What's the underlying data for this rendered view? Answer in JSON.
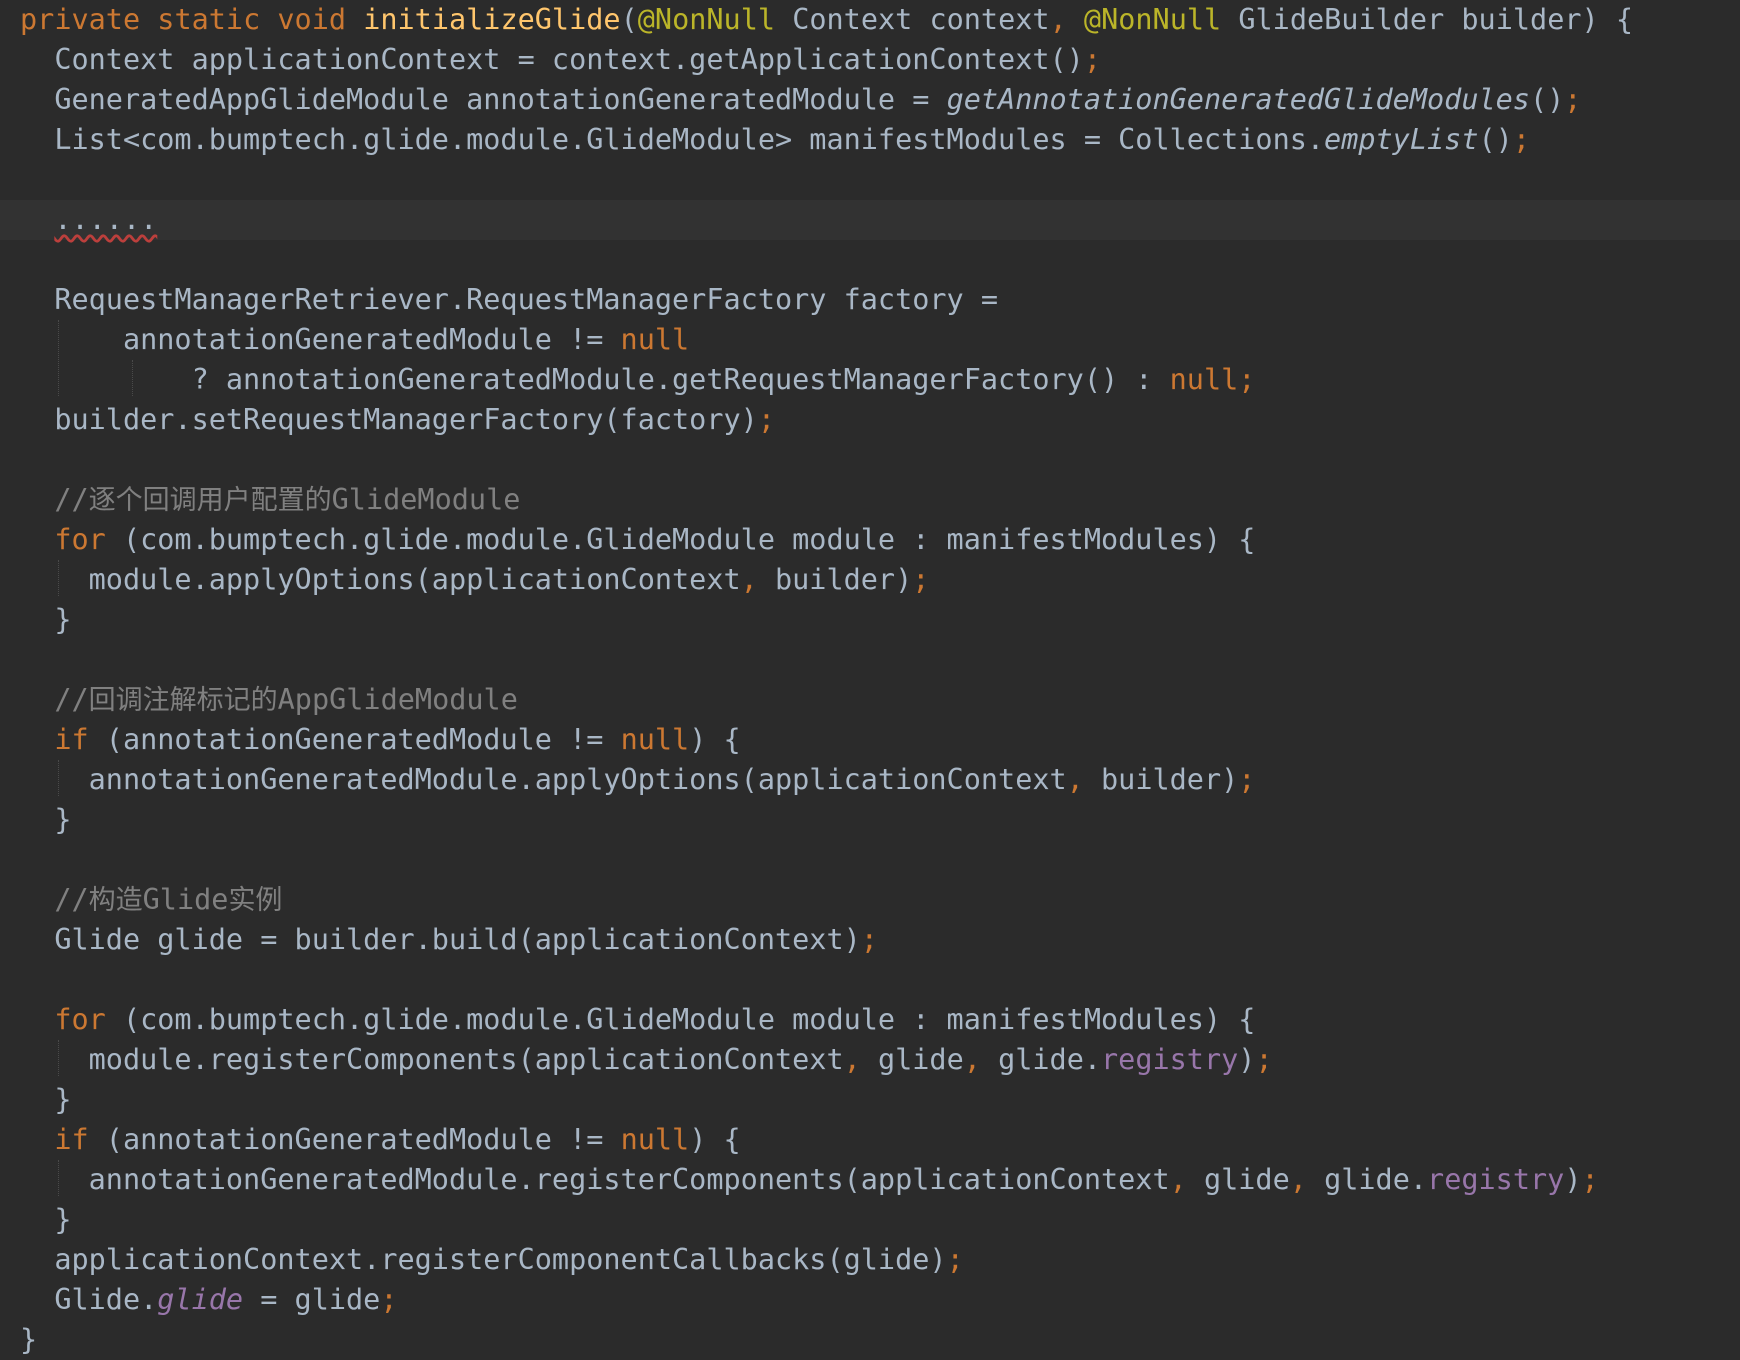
{
  "editor": {
    "lines": [
      [
        [
          "kw",
          "private "
        ],
        [
          "kw",
          "static "
        ],
        [
          "kw",
          "void "
        ],
        [
          "fn",
          "initializeGlide"
        ],
        [
          "",
          "("
        ],
        [
          "ann",
          "@NonNull "
        ],
        [
          "",
          "Context context"
        ],
        [
          "kw",
          ", "
        ],
        [
          "ann",
          "@NonNull "
        ],
        [
          "",
          "GlideBuilder builder) {"
        ]
      ],
      [
        [
          "",
          "  Context applicationContext = context.getApplicationContext()"
        ],
        [
          "kw",
          ";"
        ]
      ],
      [
        [
          "",
          "  GeneratedAppGlideModule annotationGeneratedModule = "
        ],
        [
          "it",
          "getAnnotationGeneratedGlideModules"
        ],
        [
          "",
          "()"
        ],
        [
          "kw",
          ";"
        ]
      ],
      [
        [
          "",
          "  List<com.bumptech.glide.module.GlideModule> manifestModules = Collections."
        ],
        [
          "it",
          "emptyList"
        ],
        [
          "",
          "()"
        ],
        [
          "kw",
          ";"
        ]
      ],
      [],
      [
        [
          "",
          "  "
        ],
        [
          "squiggle",
          "......"
        ]
      ],
      [],
      [
        [
          "",
          "  RequestManagerRetriever.RequestManagerFactory factory ="
        ]
      ],
      [
        [
          "",
          "      annotationGeneratedModule != "
        ],
        [
          "kw",
          "null"
        ]
      ],
      [
        [
          "",
          "          ? annotationGeneratedModule.getRequestManagerFactory() : "
        ],
        [
          "kw",
          "null;"
        ]
      ],
      [
        [
          "",
          "  builder.setRequestManagerFactory(factory)"
        ],
        [
          "kw",
          ";"
        ]
      ],
      [],
      [
        [
          "cmt",
          "  //"
        ],
        [
          "cmt cjk",
          "逐个回调用户配置的"
        ],
        [
          "cmt",
          "GlideModule"
        ]
      ],
      [
        [
          "kw",
          "  for "
        ],
        [
          "",
          "(com.bumptech.glide.module.GlideModule module : manifestModules) {"
        ]
      ],
      [
        [
          "",
          "    module.applyOptions(applicationContext"
        ],
        [
          "kw",
          ", "
        ],
        [
          "",
          "builder)"
        ],
        [
          "kw",
          ";"
        ]
      ],
      [
        [
          "",
          "  }"
        ]
      ],
      [],
      [
        [
          "cmt",
          "  //"
        ],
        [
          "cmt cjk",
          "回调注解标记的"
        ],
        [
          "cmt",
          "AppGlideModule"
        ]
      ],
      [
        [
          "kw",
          "  if "
        ],
        [
          "",
          "(annotationGeneratedModule != "
        ],
        [
          "kw",
          "null"
        ],
        [
          "",
          ") {"
        ]
      ],
      [
        [
          "",
          "    annotationGeneratedModule.applyOptions(applicationContext"
        ],
        [
          "kw",
          ", "
        ],
        [
          "",
          "builder)"
        ],
        [
          "kw",
          ";"
        ]
      ],
      [
        [
          "",
          "  }"
        ]
      ],
      [],
      [
        [
          "cmt",
          "  //"
        ],
        [
          "cmt cjk",
          "构造"
        ],
        [
          "cmt",
          "Glide"
        ],
        [
          "cmt cjk",
          "实例"
        ]
      ],
      [
        [
          "",
          "  Glide glide = builder.build(applicationContext)"
        ],
        [
          "kw",
          ";"
        ]
      ],
      [],
      [
        [
          "kw",
          "  for "
        ],
        [
          "",
          "(com.bumptech.glide.module.GlideModule module : manifestModules) {"
        ]
      ],
      [
        [
          "",
          "    module.registerComponents(applicationContext"
        ],
        [
          "kw",
          ", "
        ],
        [
          "",
          "glide"
        ],
        [
          "kw",
          ", "
        ],
        [
          "",
          "glide."
        ],
        [
          "field",
          "registry"
        ],
        [
          "",
          ")"
        ],
        [
          "kw",
          ";"
        ]
      ],
      [
        [
          "",
          "  }"
        ]
      ],
      [
        [
          "kw",
          "  if "
        ],
        [
          "",
          "(annotationGeneratedModule != "
        ],
        [
          "kw",
          "null"
        ],
        [
          "",
          ") {"
        ]
      ],
      [
        [
          "",
          "    annotationGeneratedModule.registerComponents(applicationContext"
        ],
        [
          "kw",
          ", "
        ],
        [
          "",
          "glide"
        ],
        [
          "kw",
          ", "
        ],
        [
          "",
          "glide."
        ],
        [
          "field",
          "registry"
        ],
        [
          "",
          ")"
        ],
        [
          "kw",
          ";"
        ]
      ],
      [
        [
          "",
          "  }"
        ]
      ],
      [
        [
          "",
          "  applicationContext.registerComponentCallbacks(glide)"
        ],
        [
          "kw",
          ";"
        ]
      ],
      [
        [
          "",
          "  Glide."
        ],
        [
          "field it",
          "glide"
        ],
        [
          "",
          " = glide"
        ],
        [
          "kw",
          ";"
        ]
      ],
      [
        [
          "",
          "}"
        ]
      ]
    ]
  },
  "colors": {
    "background": "#2b2b2b",
    "current_line": "#323232",
    "default_text": "#a9b7c6",
    "keyword": "#cc7832",
    "annotation": "#bbb529",
    "method_declaration": "#ffc66d",
    "field": "#9876aa",
    "comment": "#808080",
    "error_underline": "#bc3f3c"
  }
}
